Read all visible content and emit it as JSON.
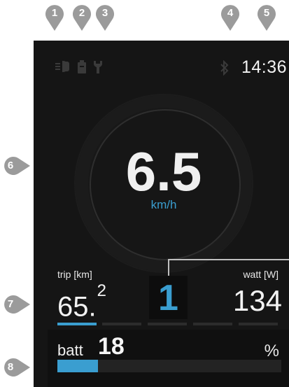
{
  "callouts": [
    "1",
    "2",
    "3",
    "4",
    "5",
    "6",
    "7",
    "8"
  ],
  "status": {
    "icons": [
      "light-icon",
      "battery-icon",
      "wrench-icon"
    ],
    "bluetooth_icon": "bluetooth-icon",
    "time": "14:36"
  },
  "speed": {
    "value": "6.5",
    "unit": "km/h"
  },
  "trip": {
    "label": "trip [km]",
    "value": "65.",
    "decimal": "2"
  },
  "assist_level": {
    "value": "1",
    "segments_total": 5,
    "segments_active": 1
  },
  "power": {
    "label": "watt [W]",
    "value": "134"
  },
  "battery": {
    "label": "batt",
    "value": "18",
    "unit": "%",
    "fraction": 0.18
  },
  "colors": {
    "accent": "#3a9ed0",
    "screen_bg": "#151515",
    "callout": "#9b9b9b"
  }
}
